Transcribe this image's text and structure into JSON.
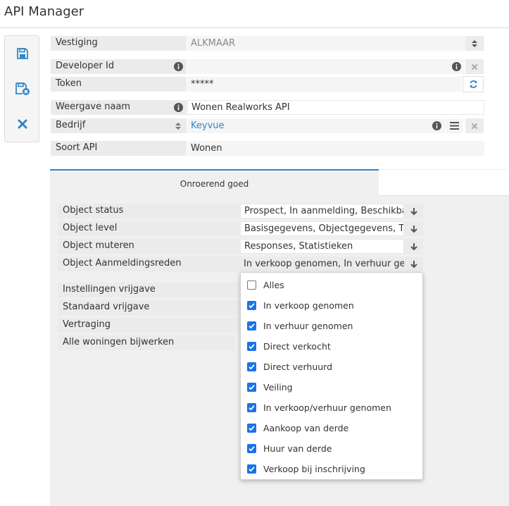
{
  "app": {
    "title": "API Manager"
  },
  "toolbar": {
    "save_icon": "floppy-disk-icon",
    "save_close_icon": "floppy-disk-x-icon",
    "cancel_icon": "x-icon"
  },
  "form": {
    "vestiging": {
      "label": "Vestiging",
      "value": "ALKMAAR"
    },
    "developer_id": {
      "label": "Developer Id",
      "value": ""
    },
    "token": {
      "label": "Token",
      "value": "*****"
    },
    "weergave_naam": {
      "label": "Weergave naam",
      "value": "Wonen Realworks API"
    },
    "bedrijf": {
      "label": "Bedrijf",
      "value": "Keyvue"
    },
    "soort_api": {
      "label": "Soort API",
      "value": "Wonen"
    }
  },
  "tabs": [
    {
      "label": "Onroerend goed",
      "active": true
    },
    {
      "label": "",
      "active": false
    }
  ],
  "object_fields": [
    {
      "label": "Object status",
      "value": "Prospect, In aanmelding, Beschikbaar"
    },
    {
      "label": "Object level",
      "value": "Basisgegevens, Objectgegevens, Tra"
    },
    {
      "label": "Object muteren",
      "value": "Responses, Statistieken"
    },
    {
      "label": "Object Aanmeldingsreden",
      "value": "In verkoop genomen, In verhuur ge"
    }
  ],
  "release_fields": [
    {
      "label": "Instellingen vrijgave"
    },
    {
      "label": "Standaard vrijgave"
    },
    {
      "label": "Vertraging"
    },
    {
      "label": "Alle woningen bijwerken"
    }
  ],
  "dropdown_options": [
    {
      "label": "Alles",
      "checked": false
    },
    {
      "label": "In verkoop genomen",
      "checked": true
    },
    {
      "label": "In verhuur genomen",
      "checked": true
    },
    {
      "label": "Direct verkocht",
      "checked": true
    },
    {
      "label": "Direct verhuurd",
      "checked": true
    },
    {
      "label": "Veiling",
      "checked": true
    },
    {
      "label": "In verkoop/verhuur genomen",
      "checked": true
    },
    {
      "label": "Aankoop van derde",
      "checked": true
    },
    {
      "label": "Huur van derde",
      "checked": true
    },
    {
      "label": "Verkoop bij inschrijving",
      "checked": true
    }
  ],
  "colors": {
    "accent": "#2f86c7",
    "checkbox_checked": "#1a73e8",
    "label_bg": "#ebebeb",
    "panel_bg": "#f0f0f0"
  }
}
